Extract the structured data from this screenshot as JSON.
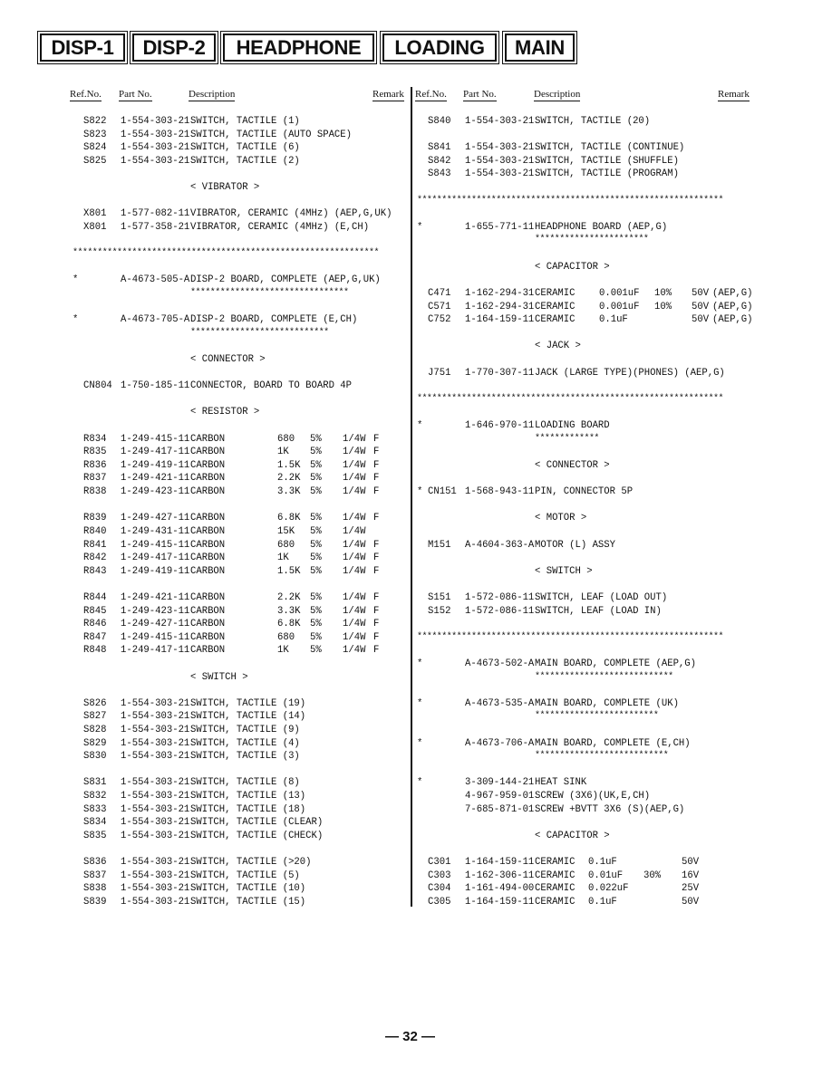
{
  "tabs": [
    "DISP-1",
    "DISP-2",
    "HEADPHONE",
    "LOADING",
    "MAIN"
  ],
  "headers": {
    "ref": "Ref.No.",
    "part": "Part No.",
    "desc": "Description",
    "remark": "Remark"
  },
  "page_number": "— 32 —",
  "left": [
    {
      "kind": "item",
      "rows": [
        {
          "ref": "S822",
          "part": "1-554-303-21",
          "desc": "SWITCH, TACTILE (1)"
        },
        {
          "ref": "S823",
          "part": "1-554-303-21",
          "desc": "SWITCH, TACTILE (AUTO SPACE)"
        },
        {
          "ref": "S824",
          "part": "1-554-303-21",
          "desc": "SWITCH, TACTILE (6)"
        },
        {
          "ref": "S825",
          "part": "1-554-303-21",
          "desc": "SWITCH, TACTILE (2)"
        }
      ]
    },
    {
      "kind": "item",
      "rows": [
        {
          "section": "< VIBRATOR >"
        }
      ]
    },
    {
      "kind": "item",
      "rows": [
        {
          "ref": "X801",
          "part": "1-577-082-11",
          "desc": "VIBRATOR, CERAMIC (4MHz) (AEP,G,UK)"
        },
        {
          "ref": "X801",
          "part": "1-577-358-21",
          "desc": "VIBRATOR, CERAMIC (4MHz) (E,CH)"
        }
      ]
    },
    {
      "kind": "item",
      "rows": [
        {
          "stars": "**************************************************************"
        }
      ]
    },
    {
      "kind": "item",
      "rows": [
        {
          "flag": "*",
          "part": "A-4673-505-A",
          "desc": "DISP-2 BOARD, COMPLETE (AEP,G,UK)"
        },
        {
          "board_stars": "********************************"
        }
      ]
    },
    {
      "kind": "item",
      "rows": [
        {
          "flag": "*",
          "part": "A-4673-705-A",
          "desc": "DISP-2 BOARD, COMPLETE (E,CH)"
        },
        {
          "board_stars": "****************************"
        }
      ]
    },
    {
      "kind": "item",
      "rows": [
        {
          "section": "< CONNECTOR >"
        }
      ]
    },
    {
      "kind": "item",
      "rows": [
        {
          "ref": "CN804",
          "part": "1-750-185-11",
          "desc": "CONNECTOR, BOARD TO BOARD 4P"
        }
      ]
    },
    {
      "kind": "item",
      "rows": [
        {
          "section": "< RESISTOR >"
        }
      ]
    },
    {
      "kind": "res",
      "rows": [
        {
          "ref": "R834",
          "part": "1-249-415-11",
          "desc": "CARBON",
          "val": "680",
          "tol": "5%",
          "volt": "1/4W",
          "rem": "F"
        },
        {
          "ref": "R835",
          "part": "1-249-417-11",
          "desc": "CARBON",
          "val": "1K",
          "tol": "5%",
          "volt": "1/4W",
          "rem": "F"
        },
        {
          "ref": "R836",
          "part": "1-249-419-11",
          "desc": "CARBON",
          "val": "1.5K",
          "tol": "5%",
          "volt": "1/4W",
          "rem": "F"
        },
        {
          "ref": "R837",
          "part": "1-249-421-11",
          "desc": "CARBON",
          "val": "2.2K",
          "tol": "5%",
          "volt": "1/4W",
          "rem": "F"
        },
        {
          "ref": "R838",
          "part": "1-249-423-11",
          "desc": "CARBON",
          "val": "3.3K",
          "tol": "5%",
          "volt": "1/4W",
          "rem": "F"
        }
      ]
    },
    {
      "kind": "res",
      "rows": [
        {
          "ref": "R839",
          "part": "1-249-427-11",
          "desc": "CARBON",
          "val": "6.8K",
          "tol": "5%",
          "volt": "1/4W",
          "rem": "F"
        },
        {
          "ref": "R840",
          "part": "1-249-431-11",
          "desc": "CARBON",
          "val": "15K",
          "tol": "5%",
          "volt": "1/4W",
          "rem": ""
        },
        {
          "ref": "R841",
          "part": "1-249-415-11",
          "desc": "CARBON",
          "val": "680",
          "tol": "5%",
          "volt": "1/4W",
          "rem": "F"
        },
        {
          "ref": "R842",
          "part": "1-249-417-11",
          "desc": "CARBON",
          "val": "1K",
          "tol": "5%",
          "volt": "1/4W",
          "rem": "F"
        },
        {
          "ref": "R843",
          "part": "1-249-419-11",
          "desc": "CARBON",
          "val": "1.5K",
          "tol": "5%",
          "volt": "1/4W",
          "rem": "F"
        }
      ]
    },
    {
      "kind": "res",
      "rows": [
        {
          "ref": "R844",
          "part": "1-249-421-11",
          "desc": "CARBON",
          "val": "2.2K",
          "tol": "5%",
          "volt": "1/4W",
          "rem": "F"
        },
        {
          "ref": "R845",
          "part": "1-249-423-11",
          "desc": "CARBON",
          "val": "3.3K",
          "tol": "5%",
          "volt": "1/4W",
          "rem": "F"
        },
        {
          "ref": "R846",
          "part": "1-249-427-11",
          "desc": "CARBON",
          "val": "6.8K",
          "tol": "5%",
          "volt": "1/4W",
          "rem": "F"
        },
        {
          "ref": "R847",
          "part": "1-249-415-11",
          "desc": "CARBON",
          "val": "680",
          "tol": "5%",
          "volt": "1/4W",
          "rem": "F"
        },
        {
          "ref": "R848",
          "part": "1-249-417-11",
          "desc": "CARBON",
          "val": "1K",
          "tol": "5%",
          "volt": "1/4W",
          "rem": "F"
        }
      ]
    },
    {
      "kind": "item",
      "rows": [
        {
          "section": "< SWITCH >"
        }
      ]
    },
    {
      "kind": "item",
      "rows": [
        {
          "ref": "S826",
          "part": "1-554-303-21",
          "desc": "SWITCH, TACTILE (19)"
        },
        {
          "ref": "S827",
          "part": "1-554-303-21",
          "desc": "SWITCH, TACTILE (14)"
        },
        {
          "ref": "S828",
          "part": "1-554-303-21",
          "desc": "SWITCH, TACTILE (9)"
        },
        {
          "ref": "S829",
          "part": "1-554-303-21",
          "desc": "SWITCH, TACTILE (4)"
        },
        {
          "ref": "S830",
          "part": "1-554-303-21",
          "desc": "SWITCH, TACTILE (3)"
        }
      ]
    },
    {
      "kind": "item",
      "rows": [
        {
          "ref": "S831",
          "part": "1-554-303-21",
          "desc": "SWITCH, TACTILE (8)"
        },
        {
          "ref": "S832",
          "part": "1-554-303-21",
          "desc": "SWITCH, TACTILE (13)"
        },
        {
          "ref": "S833",
          "part": "1-554-303-21",
          "desc": "SWITCH, TACTILE (18)"
        },
        {
          "ref": "S834",
          "part": "1-554-303-21",
          "desc": "SWITCH, TACTILE (CLEAR)"
        },
        {
          "ref": "S835",
          "part": "1-554-303-21",
          "desc": "SWITCH, TACTILE (CHECK)"
        }
      ]
    },
    {
      "kind": "item",
      "rows": [
        {
          "ref": "S836",
          "part": "1-554-303-21",
          "desc": "SWITCH, TACTILE (>20)"
        },
        {
          "ref": "S837",
          "part": "1-554-303-21",
          "desc": "SWITCH, TACTILE (5)"
        },
        {
          "ref": "S838",
          "part": "1-554-303-21",
          "desc": "SWITCH, TACTILE (10)"
        },
        {
          "ref": "S839",
          "part": "1-554-303-21",
          "desc": "SWITCH, TACTILE (15)"
        }
      ]
    }
  ],
  "right": [
    {
      "kind": "item",
      "rows": [
        {
          "ref": "S840",
          "part": "1-554-303-21",
          "desc": "SWITCH, TACTILE (20)"
        }
      ]
    },
    {
      "kind": "item",
      "rows": [
        {
          "ref": "S841",
          "part": "1-554-303-21",
          "desc": "SWITCH, TACTILE (CONTINUE)"
        },
        {
          "ref": "S842",
          "part": "1-554-303-21",
          "desc": "SWITCH, TACTILE (SHUFFLE)"
        },
        {
          "ref": "S843",
          "part": "1-554-303-21",
          "desc": "SWITCH, TACTILE (PROGRAM)"
        }
      ]
    },
    {
      "kind": "item",
      "rows": [
        {
          "stars": "**************************************************************"
        }
      ]
    },
    {
      "kind": "item",
      "rows": [
        {
          "flag": "*",
          "part": "1-655-771-11",
          "desc": "HEADPHONE BOARD (AEP,G)"
        },
        {
          "board_stars": "***********************"
        }
      ]
    },
    {
      "kind": "item",
      "rows": [
        {
          "section": "< CAPACITOR >"
        }
      ]
    },
    {
      "kind": "caphp",
      "rows": [
        {
          "ref": "C471",
          "part": "1-162-294-31",
          "desc": "CERAMIC",
          "val": "0.001uF",
          "tol": "10%",
          "volt": "50V",
          "rem": "(AEP,G)"
        },
        {
          "ref": "C571",
          "part": "1-162-294-31",
          "desc": "CERAMIC",
          "val": "0.001uF",
          "tol": "10%",
          "volt": "50V",
          "rem": "(AEP,G)"
        },
        {
          "ref": "C752",
          "part": "1-164-159-11",
          "desc": "CERAMIC",
          "val": "0.1uF",
          "tol": "",
          "volt": "50V",
          "rem": "(AEP,G)"
        }
      ]
    },
    {
      "kind": "item",
      "rows": [
        {
          "section": "< JACK >"
        }
      ]
    },
    {
      "kind": "item",
      "rows": [
        {
          "ref": "J751",
          "part": "1-770-307-11",
          "desc": "JACK (LARGE TYPE)(PHONES) (AEP,G)"
        }
      ]
    },
    {
      "kind": "item",
      "rows": [
        {
          "stars": "**************************************************************"
        }
      ]
    },
    {
      "kind": "item",
      "rows": [
        {
          "flag": "*",
          "part": "1-646-970-11",
          "desc": "LOADING BOARD"
        },
        {
          "board_stars": "*************"
        }
      ]
    },
    {
      "kind": "item",
      "rows": [
        {
          "section": "< CONNECTOR >"
        }
      ]
    },
    {
      "kind": "item",
      "rows": [
        {
          "flag": "*",
          "ref": "CN151",
          "part": "1-568-943-11",
          "desc": "PIN, CONNECTOR 5P"
        }
      ]
    },
    {
      "kind": "item",
      "rows": [
        {
          "section": "< MOTOR >"
        }
      ]
    },
    {
      "kind": "item",
      "rows": [
        {
          "ref": "M151",
          "part": "A-4604-363-A",
          "desc": "MOTOR (L) ASSY"
        }
      ]
    },
    {
      "kind": "item",
      "rows": [
        {
          "section": "< SWITCH >"
        }
      ]
    },
    {
      "kind": "item",
      "rows": [
        {
          "ref": "S151",
          "part": "1-572-086-11",
          "desc": "SWITCH, LEAF (LOAD OUT)"
        },
        {
          "ref": "S152",
          "part": "1-572-086-11",
          "desc": "SWITCH, LEAF (LOAD IN)"
        }
      ]
    },
    {
      "kind": "item",
      "rows": [
        {
          "stars": "**************************************************************"
        }
      ]
    },
    {
      "kind": "item",
      "rows": [
        {
          "flag": "*",
          "part": "A-4673-502-A",
          "desc": "MAIN BOARD, COMPLETE (AEP,G)"
        },
        {
          "board_stars": "****************************"
        }
      ]
    },
    {
      "kind": "item",
      "rows": [
        {
          "flag": "*",
          "part": "A-4673-535-A",
          "desc": "MAIN BOARD, COMPLETE (UK)"
        },
        {
          "board_stars": "*************************"
        }
      ]
    },
    {
      "kind": "item",
      "rows": [
        {
          "flag": "*",
          "part": "A-4673-706-A",
          "desc": "MAIN BOARD, COMPLETE (E,CH)"
        },
        {
          "board_stars": "***************************"
        }
      ]
    },
    {
      "kind": "item",
      "rows": [
        {
          "flag": "*",
          "part": "3-309-144-21",
          "desc": "HEAT SINK"
        },
        {
          "part": "4-967-959-01",
          "desc": "SCREW (3X6)(UK,E,CH)"
        },
        {
          "part": "7-685-871-01",
          "desc": "SCREW +BVTT 3X6 (S)(AEP,G)"
        }
      ]
    },
    {
      "kind": "item",
      "rows": [
        {
          "section": "< CAPACITOR >"
        }
      ]
    },
    {
      "kind": "capmain",
      "rows": [
        {
          "ref": "C301",
          "part": "1-164-159-11",
          "desc": "CERAMIC",
          "val": "0.1uF",
          "tol": "",
          "volt": "50V"
        },
        {
          "ref": "C303",
          "part": "1-162-306-11",
          "desc": "CERAMIC",
          "val": "0.01uF",
          "tol": "30%",
          "volt": "16V"
        },
        {
          "ref": "C304",
          "part": "1-161-494-00",
          "desc": "CERAMIC",
          "val": "0.022uF",
          "tol": "",
          "volt": "25V"
        },
        {
          "ref": "C305",
          "part": "1-164-159-11",
          "desc": "CERAMIC",
          "val": "0.1uF",
          "tol": "",
          "volt": "50V"
        }
      ]
    }
  ]
}
